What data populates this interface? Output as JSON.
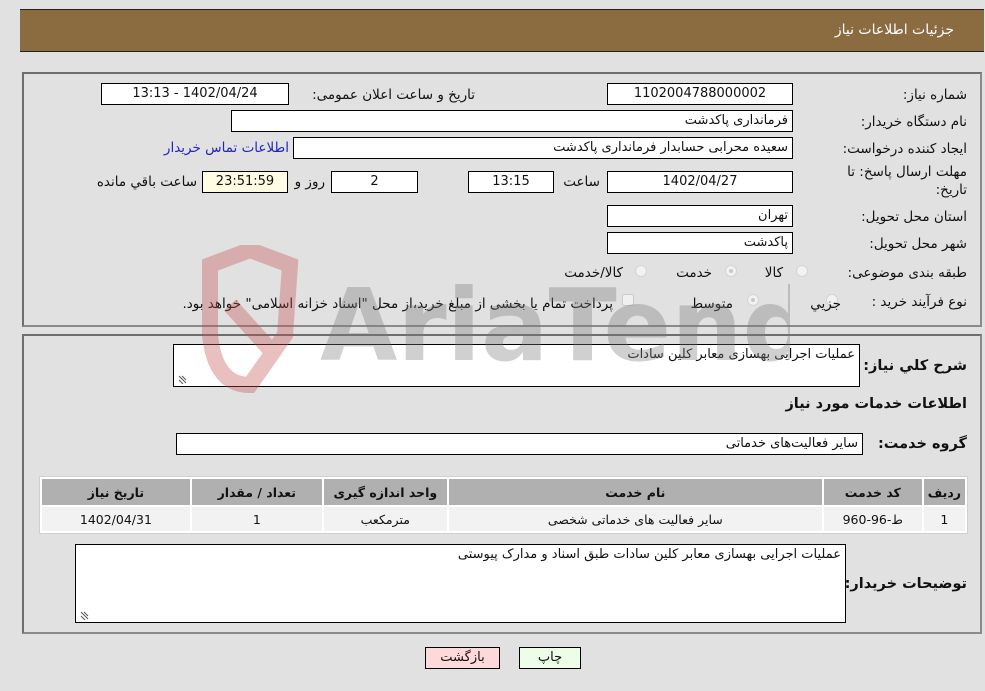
{
  "header": {
    "title": "جزئیات اطلاعات نیاز"
  },
  "form": {
    "need_number_label": "شماره نیاز:",
    "need_number": "1102004788000002",
    "announce_label": "تاریخ و ساعت اعلان عمومی:",
    "announce_value": "1402/04/24 - 13:13",
    "buyer_org_label": "نام دستگاه خریدار:",
    "buyer_org": "فرمانداری پاکدشت",
    "creator_label": "ایجاد کننده درخواست:",
    "creator": "سعیده محرابی حسابدار فرمانداری پاکدشت",
    "contact_link": "اطلاعات تماس خریدار",
    "deadline_label": "مهلت ارسال پاسخ: تا تاریخ:",
    "deadline_date": "1402/04/27",
    "time_label": "ساعت",
    "deadline_time": "13:15",
    "days_value": "2",
    "days_label": "روز و",
    "remaining_time": "23:51:59",
    "remaining_label": "ساعت باقي مانده",
    "province_label": "استان محل تحویل:",
    "province": "تهران",
    "city_label": "شهر محل تحویل:",
    "city": "پاکدشت",
    "category_label": "طبقه بندی موضوعی:",
    "category_options": [
      {
        "label": "کالا",
        "checked": false
      },
      {
        "label": "خدمت",
        "checked": true
      },
      {
        "label": "کالا/خدمت",
        "checked": false
      }
    ],
    "purchase_type_label": "نوع فرآیند خرید :",
    "purchase_options": [
      {
        "label": "جزیي",
        "checked": false
      },
      {
        "label": "متوسط",
        "checked": true
      }
    ],
    "treasury_note": "پرداخت تمام یا بخشی از مبلغ خرید،از محل \"اسناد خزانه اسلامی\" خواهد بود.",
    "treasury_checked": false
  },
  "details": {
    "summary_label": "شرح كلي نياز:",
    "summary": "عملیات اجرایی بهسازی معابر کلین سادات",
    "services_heading": "اطلاعات خدمات مورد نیاز",
    "service_group_label": "گروه خدمت:",
    "service_group": "سایر فعالیت‌های خدماتی",
    "table": {
      "headers": [
        "ردیف",
        "کد خدمت",
        "نام خدمت",
        "واحد اندازه گیری",
        "تعداد / مقدار",
        "تاریخ نیاز"
      ],
      "rows": [
        [
          "1",
          "ط-96-960",
          "سایر فعالیت های خدماتی شخصی",
          "مترمکعب",
          "1",
          "1402/04/31"
        ]
      ]
    },
    "buyer_notes_label": "توضیحات خریدار:",
    "buyer_notes": "عملیات اجرایی بهسازی معابر کلین سادات طبق اسناد و مدارک پیوستی"
  },
  "buttons": {
    "print": "چاپ",
    "back": "بازگشت"
  },
  "watermark": {
    "text": "AriaTender.neT"
  },
  "colors": {
    "header_bg": "#8b6b40",
    "print_bg": "#ecfde8",
    "back_bg": "#fdd9d9",
    "link": "#2323c8"
  }
}
